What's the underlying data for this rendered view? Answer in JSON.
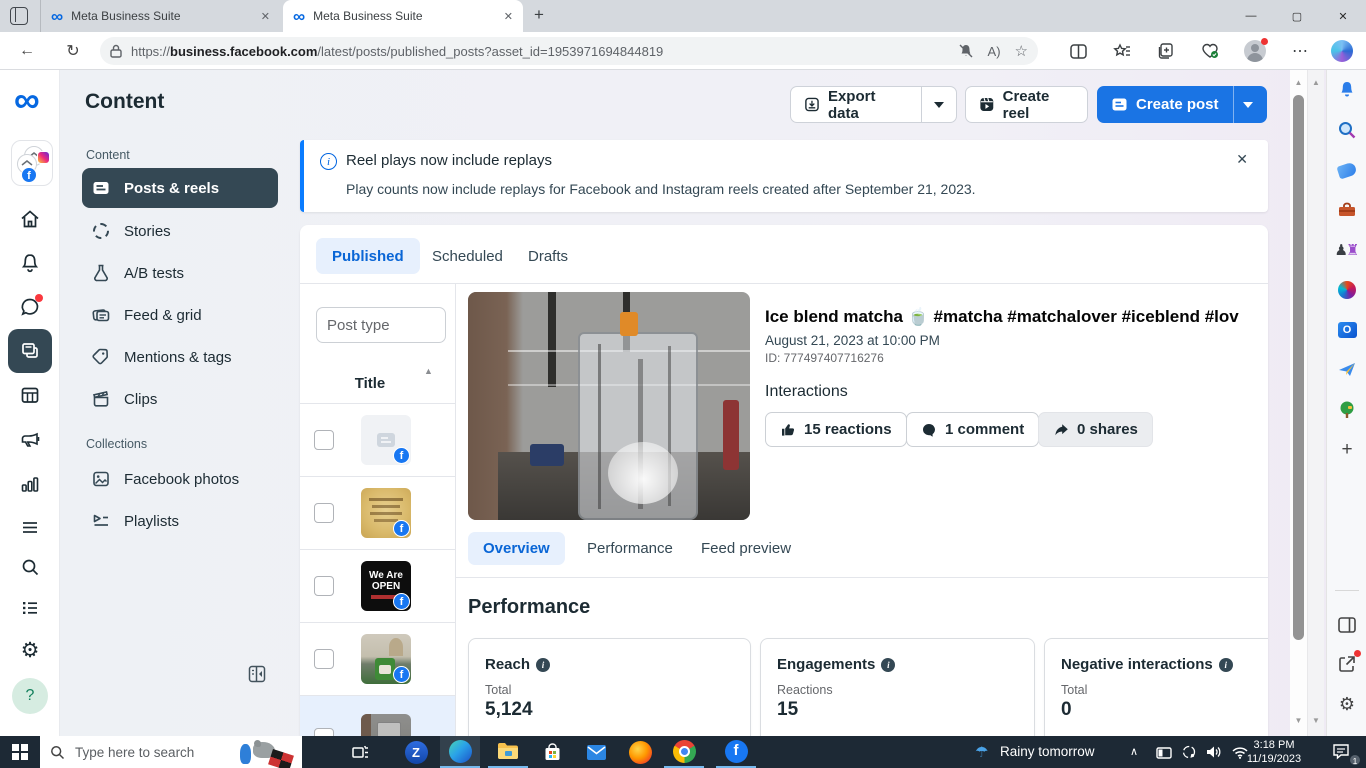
{
  "glyphs": {
    "close": "✕",
    "plus": "+",
    "infinity": "∞",
    "gear": "⚙",
    "question": "?",
    "umbrella": "☂",
    "minimize": "—",
    "maximize": "▢",
    "ellipsis": "⋯",
    "back": "←",
    "refresh": "↻",
    "caret_down": "▼",
    "caret_up": "▲",
    "chevron_up": "∧",
    "star": "☆",
    "read_aloud": "A",
    "pawn": "♟",
    "rook": "♜",
    "sort_up": "▲",
    "letter_z": "Z",
    "letter_f": "f",
    "letter_o": "O"
  },
  "browser": {
    "tabs": [
      {
        "title": "Meta Business Suite"
      },
      {
        "title": "Meta Business Suite"
      }
    ],
    "url_scheme": "https://",
    "url_host": "business.facebook.com",
    "url_path": "/latest/posts/published_posts?asset_id=1953971694844819",
    "toolbar_icons": [
      "tab-actions",
      "back",
      "refresh",
      "lock",
      "notifications-muted",
      "read-aloud",
      "favorite-star",
      "split-screen",
      "favorites-bar",
      "collections",
      "browser-essentials",
      "profile",
      "settings-menu",
      "copilot"
    ]
  },
  "app": {
    "header": {
      "title": "Content",
      "export_label": "Export data",
      "create_reel_label": "Create reel",
      "create_post_label": "Create post"
    },
    "rail_icons": [
      "meta-logo",
      "business-avatar",
      "home",
      "notifications",
      "messages",
      "content",
      "planner",
      "ads",
      "insights",
      "all-tools",
      "search",
      "tasks",
      "settings",
      "help"
    ],
    "nav": {
      "section1": "Content",
      "items": [
        "Posts & reels",
        "Stories",
        "A/B tests",
        "Feed & grid",
        "Mentions & tags",
        "Clips"
      ],
      "selected": "Posts & reels",
      "section2": "Collections",
      "collections": [
        "Facebook photos",
        "Playlists"
      ]
    },
    "banner": {
      "title": "Reel plays now include replays",
      "body": "Play counts now include replays for Facebook and Instagram reels created after September 21, 2023."
    },
    "tabs": {
      "items": [
        "Published",
        "Scheduled",
        "Drafts"
      ],
      "selected": "Published"
    },
    "list": {
      "filter_placeholder": "Post type",
      "column_title": "Title",
      "rows": [
        {
          "thumb": "text-post-placeholder"
        },
        {
          "thumb": "quote-image"
        },
        {
          "thumb": "we-are-open-sign",
          "text": "We Are OPEN"
        },
        {
          "thumb": "matcha-jar-photo"
        },
        {
          "thumb": "blender-photo",
          "selected": true
        }
      ]
    },
    "detail": {
      "title": "Ice blend matcha 🍵 #matcha #matchalover #iceblend #lov",
      "date": "August 21, 2023 at 10:00 PM",
      "post_id": "ID: 777497407716276",
      "interactions_label": "Interactions",
      "reactions": "15 reactions",
      "comments": "1 comment",
      "shares": "0 shares",
      "tabs": {
        "items": [
          "Overview",
          "Performance",
          "Feed preview"
        ],
        "selected": "Overview"
      },
      "performance_title": "Performance",
      "cards": [
        {
          "label": "Reach",
          "sub": "Total",
          "value": "5,124"
        },
        {
          "label": "Engagements",
          "sub": "Reactions",
          "value": "15"
        },
        {
          "label": "Negative interactions",
          "sub": "Total",
          "value": "0"
        }
      ]
    }
  },
  "edge_sidebar_icons": [
    "notifications",
    "search",
    "shopping",
    "tools",
    "games",
    "microsoft-365",
    "outlook",
    "drop",
    "tree-game",
    "add-to-sidebar",
    "toggle-sidebar",
    "share",
    "settings"
  ],
  "taskbar": {
    "search_placeholder": "Type here to search",
    "weather": "Rainy tomorrow",
    "time": "3:18 PM",
    "date": "11/19/2023",
    "notification_badge": "1",
    "app_icons": [
      "start",
      "task-view",
      "zalo",
      "edge",
      "file-explorer",
      "store",
      "mail",
      "firefox",
      "chrome",
      "facebook"
    ]
  }
}
